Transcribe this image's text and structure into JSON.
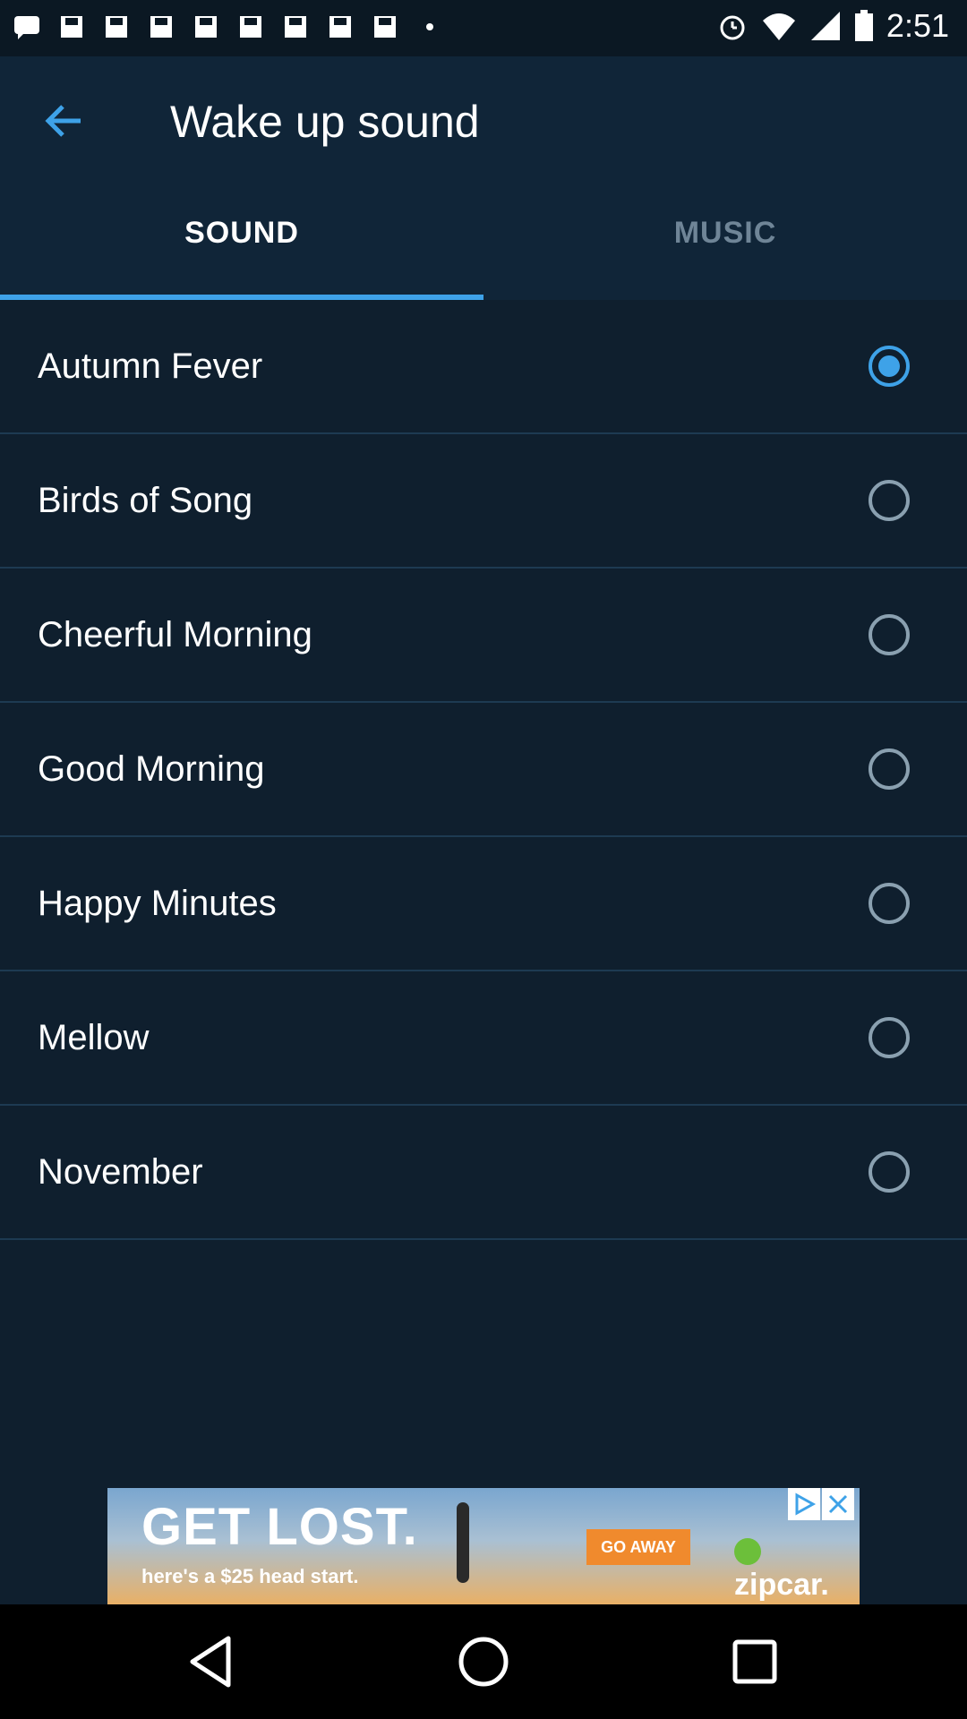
{
  "status_bar": {
    "time": "2:51",
    "left_icons": [
      "message-icon",
      "save-icon",
      "save-icon",
      "save-icon",
      "save-icon",
      "save-icon",
      "save-icon",
      "save-icon",
      "save-icon",
      "more-dots-icon"
    ],
    "right_icons": [
      "alarm-icon",
      "wifi-icon",
      "signal-icon",
      "battery-icon"
    ]
  },
  "header": {
    "title": "Wake up sound",
    "back_icon": "back-arrow-icon"
  },
  "tabs": [
    {
      "label": "SOUND",
      "selected": true
    },
    {
      "label": "MUSIC",
      "selected": false
    }
  ],
  "sounds": [
    {
      "label": "Autumn Fever",
      "selected": true
    },
    {
      "label": "Birds of Song",
      "selected": false
    },
    {
      "label": "Cheerful Morning",
      "selected": false
    },
    {
      "label": "Good Morning",
      "selected": false
    },
    {
      "label": "Happy Minutes",
      "selected": false
    },
    {
      "label": "Mellow",
      "selected": false
    },
    {
      "label": "November",
      "selected": false
    }
  ],
  "ad": {
    "headline": "GET LOST.",
    "subline": "here's a $25 head start.",
    "cta": "GO AWAY",
    "brand": "zipcar."
  },
  "nav": [
    "back-triangle-icon",
    "home-circle-icon",
    "recents-square-icon"
  ],
  "colors": {
    "background": "#0f1f2e",
    "appbar": "#102538",
    "accent": "#3ea2e8",
    "inactive_tab": "#6f8597"
  }
}
